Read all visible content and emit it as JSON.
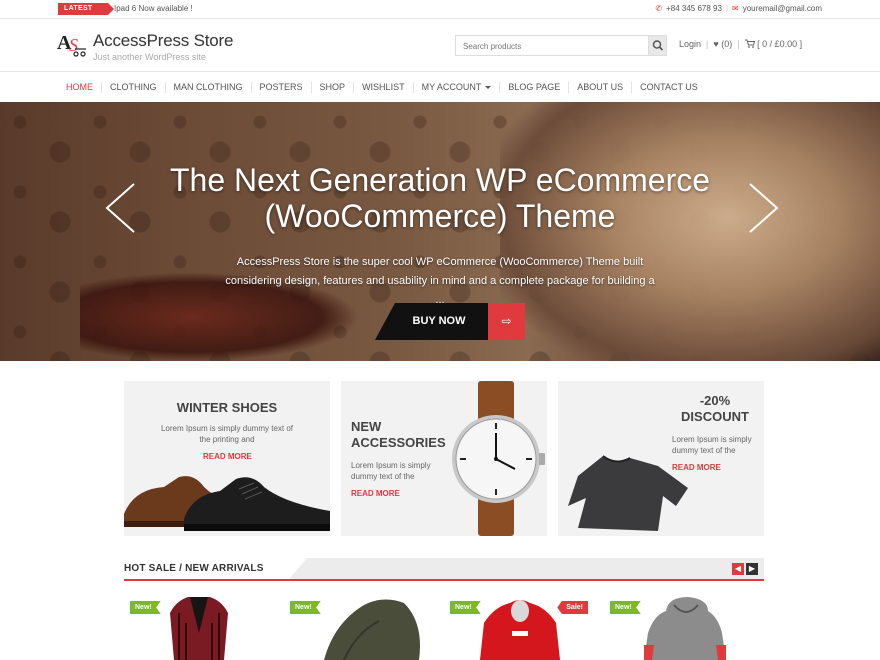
{
  "topbar": {
    "tag": "LATEST",
    "ticker": "Ipad 6 Now available !",
    "phone": "+84 345 678 93",
    "email": "youremail@gmail.com"
  },
  "header": {
    "site_title": "AccessPress Store",
    "tagline": "Just another WordPress site",
    "search_placeholder": "Search products",
    "login": "Login",
    "wishlist": "(0)",
    "cart": "[ 0 / £0.00 ]"
  },
  "nav": {
    "items": [
      {
        "label": "HOME"
      },
      {
        "label": "CLOTHING"
      },
      {
        "label": "MAN CLOTHING"
      },
      {
        "label": "POSTERS"
      },
      {
        "label": "SHOP"
      },
      {
        "label": "WISHLIST"
      },
      {
        "label": "MY ACCOUNT"
      },
      {
        "label": "BLOG PAGE"
      },
      {
        "label": "ABOUT US"
      },
      {
        "label": "CONTACT US"
      }
    ]
  },
  "slider": {
    "title_line1": "The Next Generation WP eCommerce",
    "title_line2": "(WooCommerce) Theme",
    "text_line1": "AccessPress Store is the super cool WP eCommerce (WooCommerce) Theme  built",
    "text_line2": "considering design, features and usability in mind and a complete package for building a ...",
    "button": "BUY NOW"
  },
  "promos": [
    {
      "title": "WINTER SHOES",
      "text_line1": "Lorem Ipsum is simply dummy text of",
      "text_line2": "the printing and",
      "more": "READ MORE"
    },
    {
      "title_line1": "NEW",
      "title_line2": "ACCESSORIES",
      "text_line1": "Lorem Ipsum is simply",
      "text_line2": "dummy text of the",
      "more": "READ MORE"
    },
    {
      "title_line1": "-20%",
      "title_line2": "DISCOUNT",
      "text_line1": "Lorem Ipsum is simply",
      "text_line2": "dummy text of the",
      "more": "READ MORE"
    }
  ],
  "hot_sale": {
    "title": "HOT  SALE  /  NEW  ARRIVALS",
    "products": [
      {
        "badge": "New!"
      },
      {
        "badge": "New!"
      },
      {
        "badge": "New!",
        "badge2": "Sale!"
      },
      {
        "badge": "New!"
      }
    ]
  },
  "colors": {
    "accent": "#e03a3e",
    "new_badge": "#7bb928"
  }
}
